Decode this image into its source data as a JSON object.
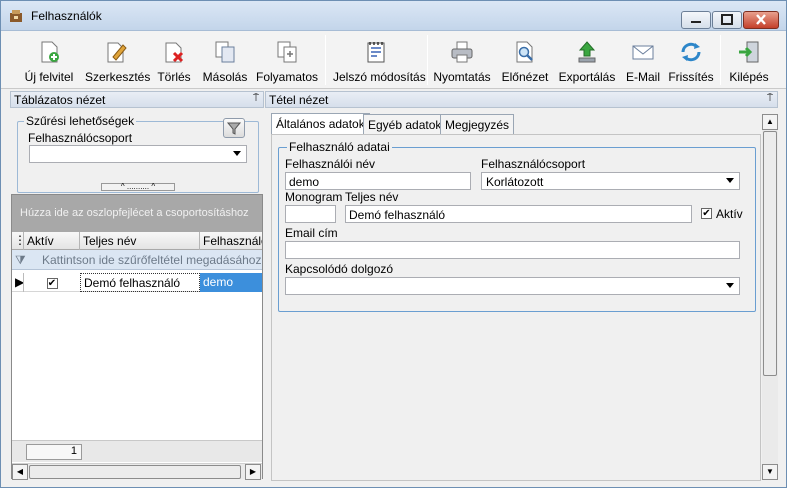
{
  "window": {
    "title": "Felhasználók"
  },
  "toolbar": {
    "new": "Új felvitel",
    "edit": "Szerkesztés",
    "delete": "Törlés",
    "copy": "Másolás",
    "continuous": "Folyamatos",
    "password": "Jelszó módosítás",
    "print": "Nyomtatás",
    "preview": "Előnézet",
    "export": "Exportálás",
    "email": "E-Mail",
    "refresh": "Frissítés",
    "exit": "Kilépés"
  },
  "left_panel": {
    "title": "Táblázatos nézet",
    "filter_group": "Szűrési lehetőségek",
    "filter_label": "Felhasználócsoport",
    "filter_value": "",
    "group_hint": "Húzza ide az oszlopfejlécet a csoportosításhoz",
    "columns": [
      "Aktív",
      "Teljes név",
      "Felhasználói"
    ],
    "filter_row": "Kattintson ide szűrőfeltétel megadásához",
    "rows": [
      {
        "active": true,
        "full_name": "Demó felhasználó",
        "username": "demo"
      }
    ],
    "record_counter": "1"
  },
  "right_panel": {
    "title": "Tétel nézet",
    "tabs": [
      "Általános adatok",
      "Egyéb adatok",
      "Megjegyzés"
    ],
    "group_title": "Felhasználó adatai",
    "username_label": "Felhasználói név",
    "username_value": "demo",
    "usergroup_label": "Felhasználócsoport",
    "usergroup_value": "Korlátozott",
    "monogram_label": "Monogram",
    "monogram_value": "",
    "fullname_label": "Teljes név",
    "fullname_value": "Demó felhasználó",
    "active_label": "Aktív",
    "active_checked": true,
    "email_label": "Email cím",
    "email_value": "",
    "employee_label": "Kapcsolódó dolgozó",
    "employee_value": ""
  },
  "colors": {
    "selection": "#3c8fdc",
    "group_border": "#6a9ed1"
  }
}
